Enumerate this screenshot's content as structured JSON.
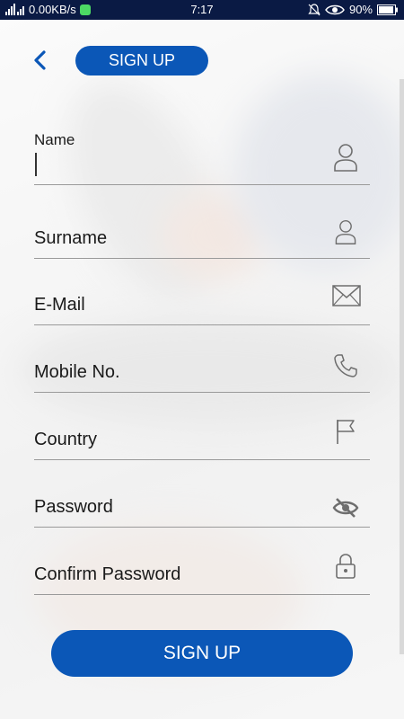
{
  "status_bar": {
    "network_speed": "0.00KB/s",
    "time": "7:17",
    "battery": "90%"
  },
  "header": {
    "title": "SIGN UP"
  },
  "form": {
    "fields": [
      {
        "label": "Name",
        "icon": "person-icon",
        "value": ""
      },
      {
        "label": "Surname",
        "icon": "person-icon"
      },
      {
        "label": "E-Mail",
        "icon": "envelope-icon"
      },
      {
        "label": "Mobile No.",
        "icon": "phone-icon"
      },
      {
        "label": "Country",
        "icon": "flag-icon"
      },
      {
        "label": "Password",
        "icon": "eye-slash-icon"
      },
      {
        "label": "Confirm Password",
        "icon": "lock-icon"
      }
    ],
    "submit_label": "SIGN UP"
  },
  "colors": {
    "accent": "#0b57b7",
    "status_bar": "#0a1a44"
  }
}
